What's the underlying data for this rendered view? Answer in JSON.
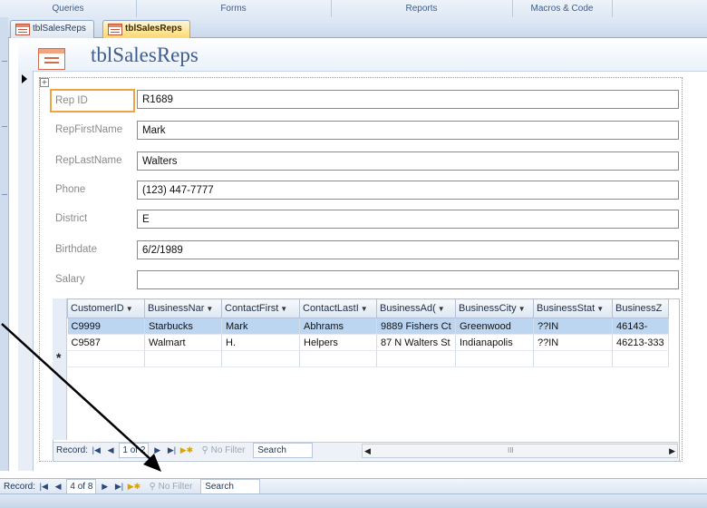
{
  "ribbon_groups": [
    "Queries",
    "Forms",
    "Reports",
    "Macros & Code"
  ],
  "doc_tabs": [
    {
      "label": "tblSalesReps",
      "active": false
    },
    {
      "label": "tblSalesReps",
      "active": true
    }
  ],
  "form": {
    "title": "tblSalesReps",
    "fields": [
      {
        "label": "Rep ID",
        "value": "R1689"
      },
      {
        "label": "RepFirstName",
        "value": "Mark"
      },
      {
        "label": "RepLastName",
        "value": "Walters"
      },
      {
        "label": "Phone",
        "value": "(123) 447-7777"
      },
      {
        "label": "District",
        "value": "E"
      },
      {
        "label": "Birthdate",
        "value": "6/2/1989"
      },
      {
        "label": "Salary",
        "value": ""
      }
    ]
  },
  "subform": {
    "columns": [
      "CustomerID",
      "BusinessNar",
      "ContactFirst",
      "ContactLastI",
      "BusinessAd(",
      "BusinessCity",
      "BusinessStat",
      "BusinessZ"
    ],
    "rows": [
      [
        "C9999",
        "Starbucks",
        "Mark",
        "Abhrams",
        "9889 Fishers Ct",
        "Greenwood",
        "??IN",
        "46143-"
      ],
      [
        "C9587",
        "Walmart",
        "H.",
        "Helpers",
        "87 N Walters St",
        "Indianapolis",
        "??IN",
        "46213-333"
      ]
    ],
    "new_row_marker": "*",
    "nav": {
      "record_label": "Record:",
      "position": "1 of 2",
      "filter_label": "No Filter",
      "search_label": "Search",
      "scroll_glyph": "III"
    }
  },
  "main_nav": {
    "record_label": "Record:",
    "position": "4 of 8",
    "filter_label": "No Filter",
    "search_label": "Search"
  },
  "colors": {
    "accent_focus": "#f0a340",
    "selected_row": "#bcd6f2",
    "annotation_arrow": "#000000"
  }
}
